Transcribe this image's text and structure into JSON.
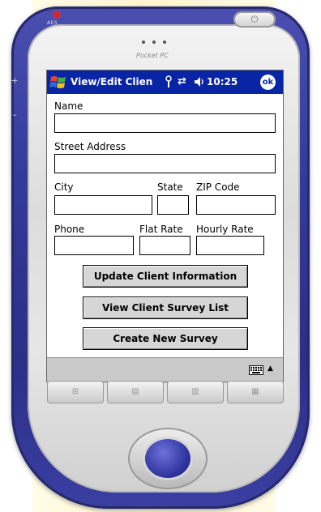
{
  "device": {
    "brand": "Pocket PC",
    "led_label": "AES",
    "hardware_keys": [
      "⊞",
      "▤",
      "▥",
      "▦"
    ]
  },
  "titlebar": {
    "title": "View/Edit Clien",
    "time": "10:25",
    "ok_label": "ok"
  },
  "form": {
    "name_label": "Name",
    "street_label": "Street Address",
    "city_label": "City",
    "state_label": "State",
    "zip_label": "ZIP Code",
    "phone_label": "Phone",
    "flat_rate_label": "Flat Rate",
    "hourly_rate_label": "Hourly Rate",
    "name_value": "",
    "street_value": "",
    "city_value": "",
    "state_value": "",
    "zip_value": "",
    "phone_value": "",
    "flat_rate_value": "",
    "hourly_rate_value": ""
  },
  "buttons": {
    "update": "Update Client Information",
    "view_list": "View Client Survey List",
    "create": "Create New Survey"
  },
  "colors": {
    "titlebar": "#0a24a6",
    "device_body": "#343a98",
    "menubar": "#c9c9c9"
  }
}
